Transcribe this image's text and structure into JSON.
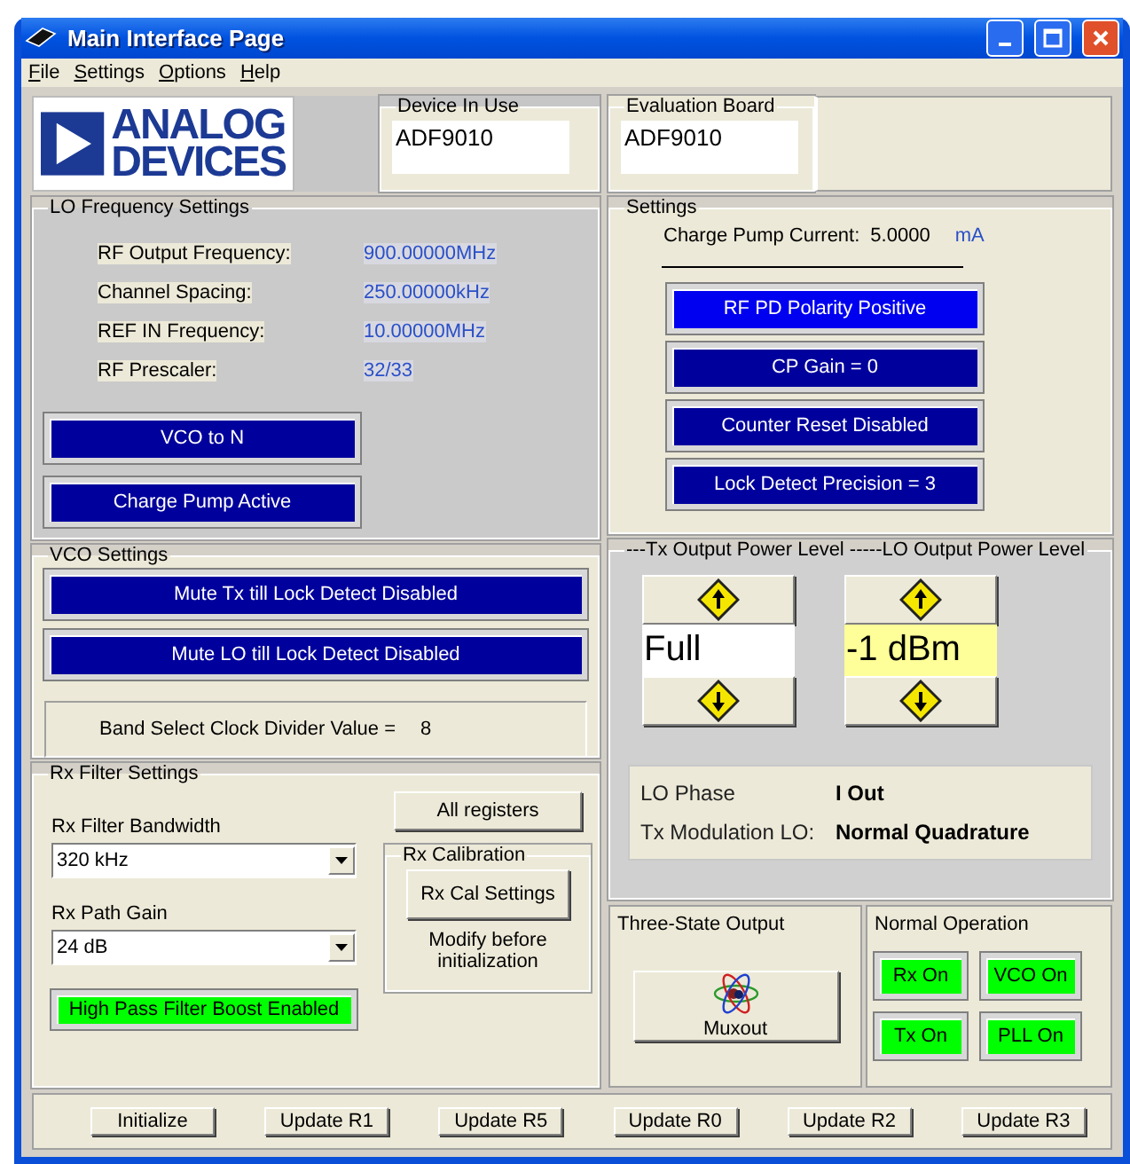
{
  "window": {
    "title": "Main Interface Page"
  },
  "menu": [
    "File",
    "Settings",
    "Options",
    "Help"
  ],
  "logo": {
    "lines": [
      "ANALOG",
      "DEVICES"
    ]
  },
  "device_in_use": {
    "label": "Device In Use",
    "value": "ADF9010"
  },
  "evaluation_board": {
    "label": "Evaluation Board",
    "value": "ADF9010"
  },
  "lo_frequency_settings": {
    "title": "LO Frequency Settings",
    "rows": [
      {
        "label": "RF Output Frequency:",
        "value": "900.00000MHz"
      },
      {
        "label": "Channel Spacing:",
        "value": "250.00000kHz"
      },
      {
        "label": "REF IN Frequency:",
        "value": "10.00000MHz"
      },
      {
        "label": "RF Prescaler:",
        "value": "32/33"
      }
    ],
    "buttons": [
      {
        "label": "VCO to N",
        "color": "#00009c"
      },
      {
        "label": "Charge Pump Active",
        "color": "#00009c"
      }
    ]
  },
  "vco_settings": {
    "title": "VCO Settings",
    "buttons": [
      {
        "label": "Mute Tx till Lock Detect Disabled",
        "color": "#00009c"
      },
      {
        "label": "Mute LO till Lock Detect Disabled",
        "color": "#00009c"
      }
    ],
    "band_select": {
      "label": "Band Select Clock Divider Value =",
      "value": "8"
    }
  },
  "rx_filter_settings": {
    "title": "Rx Filter Settings",
    "bandwidth": {
      "label": "Rx Filter Bandwidth",
      "value": "320 kHz"
    },
    "path_gain": {
      "label": "Rx Path Gain",
      "value": "24 dB"
    },
    "boost_button": {
      "label": "High Pass Filter Boost Enabled",
      "color": "#00ff00"
    },
    "all_registers_button": "All registers",
    "rx_calibration": {
      "title": "Rx Calibration",
      "button": "Rx Cal Settings",
      "note": "Modify before initialization"
    }
  },
  "settings": {
    "title": "Settings",
    "charge_pump": {
      "label": "Charge Pump Current:",
      "value": "5.0000",
      "unit": "mA"
    },
    "buttons": [
      {
        "label": "RF PD Polarity Positive",
        "color": "#0000f0"
      },
      {
        "label": "CP Gain = 0",
        "color": "#00009c"
      },
      {
        "label": "Counter Reset Disabled",
        "color": "#00009c"
      },
      {
        "label": "Lock Detect Precision = 3",
        "color": "#00009c"
      }
    ]
  },
  "power_levels": {
    "title": "---Tx Output Power Level -----LO Output Power Level",
    "spinners": [
      {
        "value": "Full",
        "color": "#ffffff"
      },
      {
        "value": "-1 dBm",
        "color": "#ffff99"
      }
    ],
    "info": [
      {
        "label": "LO Phase",
        "value": "I Out"
      },
      {
        "label": "Tx Modulation LO:",
        "value": "Normal Quadrature"
      }
    ]
  },
  "three_state_output": {
    "title": "Three-State Output",
    "button": "Muxout"
  },
  "normal_operation": {
    "title": "Normal Operation",
    "buttons": [
      {
        "label": "Rx On",
        "color": "#00ff00"
      },
      {
        "label": "VCO On",
        "color": "#00ff00"
      },
      {
        "label": "Tx On",
        "color": "#00ff00"
      },
      {
        "label": "PLL On",
        "color": "#00ff00"
      }
    ]
  },
  "bottom_buttons": [
    "Initialize",
    "Update R1",
    "Update R5",
    "Update R0",
    "Update R2",
    "Update R3"
  ]
}
